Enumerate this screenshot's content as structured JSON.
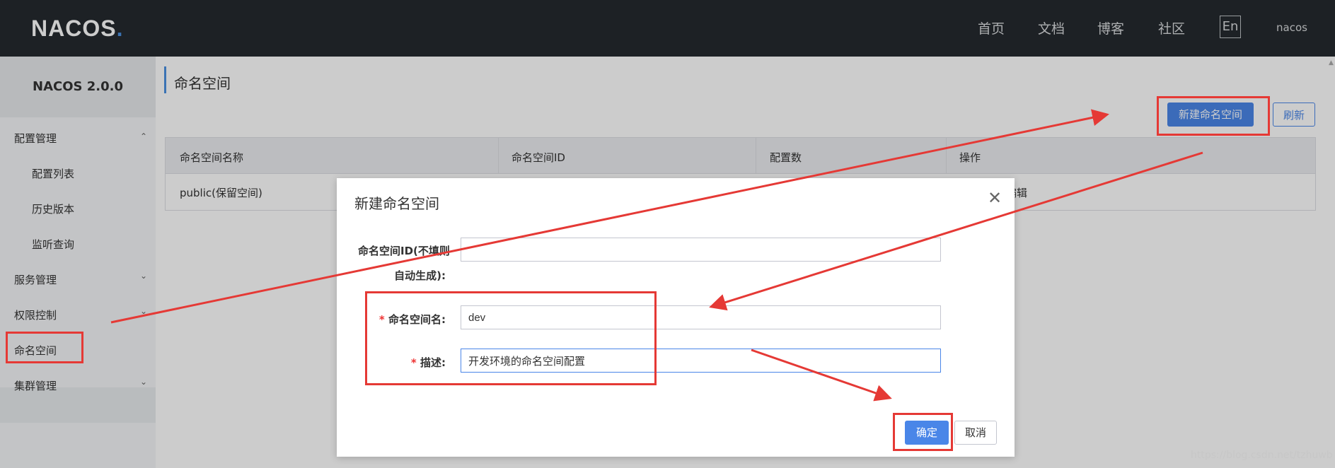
{
  "app": {
    "logo": "NACOS",
    "logo_dot": ".",
    "version": "NACOS 2.0.0"
  },
  "nav": {
    "items": [
      "首页",
      "文档",
      "博客",
      "社区"
    ],
    "lang": "En",
    "user": "nacos"
  },
  "sidebar": {
    "config_mgmt": "配置管理",
    "config_list": "配置列表",
    "history": "历史版本",
    "listen_query": "监听查询",
    "service_mgmt": "服务管理",
    "auth_control": "权限控制",
    "namespace": "命名空间",
    "cluster_mgmt": "集群管理"
  },
  "page": {
    "title": "命名空间",
    "new_ns_button": "新建命名空间",
    "refresh_button": "刷新"
  },
  "table": {
    "headers": [
      "命名空间名称",
      "命名空间ID",
      "配置数",
      "操作"
    ],
    "rows": [
      {
        "name": "public(保留空间)",
        "id": "",
        "count": "",
        "action": "编辑"
      }
    ]
  },
  "dialog": {
    "title": "新建命名空间",
    "close_icon": "close-icon",
    "ns_id_label_line1": "命名空间ID(不填则",
    "ns_id_label_line2": "自动生成):",
    "ns_id_value": "",
    "ns_name_label": "命名空间名:",
    "ns_name_value": "dev",
    "desc_label": "描述:",
    "desc_value": "开发环境的命名空间配置",
    "required_mark": "*",
    "ok_button": "确定",
    "cancel_button": "取消"
  },
  "watermark": "https://blog.csdn.net/tzhuwb",
  "colors": {
    "topbar": "#252a2f",
    "primary": "#4a86e8",
    "annotation_red": "#e53935"
  }
}
